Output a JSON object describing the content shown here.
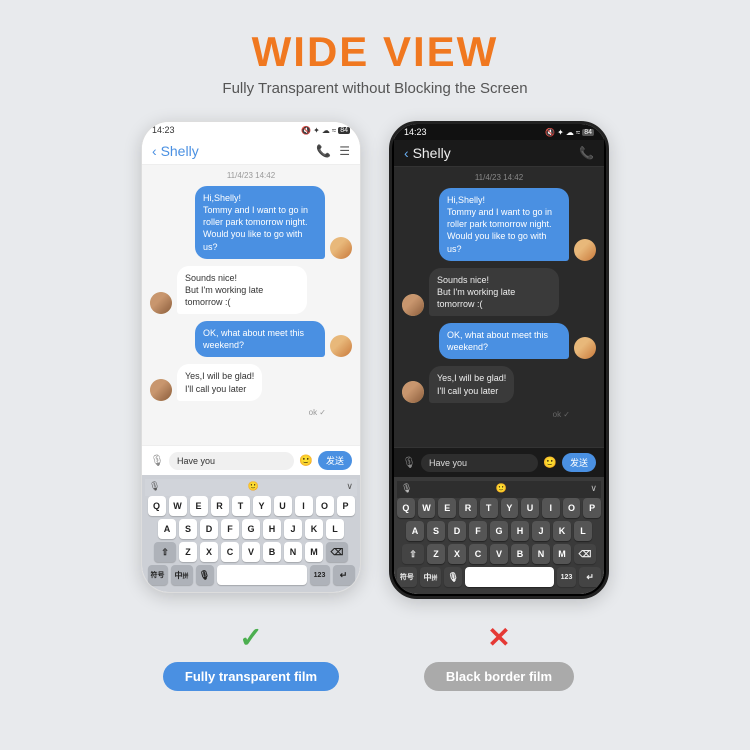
{
  "header": {
    "title": "WIDE VIEW",
    "subtitle": "Fully Transparent without Blocking the Screen"
  },
  "phone_left": {
    "type": "light",
    "status_time": "14:23",
    "status_icons": "🔇 ✦ ☁ ≈ 84",
    "chat_name": "Shelly",
    "date_label": "11/4/23 14:42",
    "messages": [
      {
        "type": "sent",
        "text": "Hi,Shelly!\nTommy and I want to go in roller park tomorrow night. Would you like to go with us?"
      },
      {
        "type": "recv",
        "text": "Sounds nice!\nBut I'm working late tomorrow :("
      },
      {
        "type": "sent",
        "text": "OK, what about meet this weekend?"
      },
      {
        "type": "recv",
        "text": "Yes,I will be glad!\nI'll call you later"
      }
    ],
    "ok_label": "ok ✓",
    "input_text": "Have you",
    "send_label": "发送"
  },
  "phone_right": {
    "type": "dark",
    "status_time": "14:23",
    "status_icons": "🔇 ✦ ☁ ≈ 84",
    "chat_name": "Shelly",
    "date_label": "11/4/23 14:42",
    "messages": [
      {
        "type": "sent",
        "text": "Hi,Shelly!\nTommy and I want to go in roller park tomorrow night. Would you like to go with us?"
      },
      {
        "type": "recv",
        "text": "Sounds nice!\nBut I'm working late tomorrow :("
      },
      {
        "type": "sent",
        "text": "OK, what about meet this weekend?"
      },
      {
        "type": "recv",
        "text": "Yes,I will be glad!\nI'll call you later"
      }
    ],
    "ok_label": "ok ✓",
    "input_text": "Have you",
    "send_label": "发送"
  },
  "labels": {
    "left_check": "✓",
    "right_cross": "✕",
    "left_label": "Fully transparent film",
    "right_label": "Black border film"
  },
  "keyboard": {
    "row1": [
      "Q",
      "W",
      "E",
      "R",
      "T",
      "Y",
      "U",
      "I",
      "O",
      "P"
    ],
    "row2": [
      "A",
      "S",
      "D",
      "F",
      "G",
      "H",
      "J",
      "K",
      "L"
    ],
    "row3": [
      "Z",
      "X",
      "C",
      "V",
      "B",
      "N",
      "M"
    ],
    "special_left": "符号",
    "special_mid": "中",
    "special_num": "123"
  }
}
